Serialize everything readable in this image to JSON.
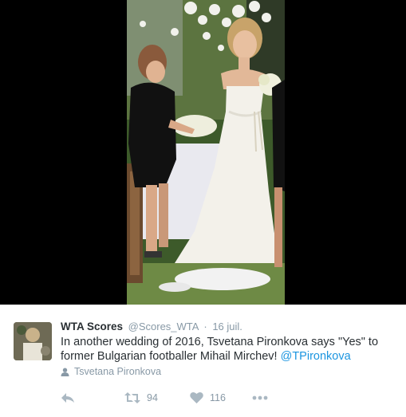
{
  "media": {
    "background": "#000000",
    "photo_description_icon": "wedding-photo"
  },
  "tweet": {
    "author_name": "WTA Scores",
    "author_handle": "@Scores_WTA",
    "separator": "·",
    "date": "16 juil.",
    "text_main": "In another wedding of 2016, Tsvetana Pironkova says \"Yes\" to former Bulgarian footballer Mihail Mirchev! ",
    "mention": "@TPironkova",
    "context_icon": "person-icon",
    "context_label": "Tsvetana Pironkova",
    "actions": {
      "reply_icon": "reply-icon",
      "retweet_icon": "retweet-icon",
      "retweet_count": "94",
      "like_icon": "heart-icon",
      "like_count": "116",
      "more_icon": "more-icon"
    },
    "colors": {
      "text": "#292f33",
      "secondary": "#8899a6",
      "link": "#1b95e0",
      "icon": "#aab8c2"
    }
  }
}
